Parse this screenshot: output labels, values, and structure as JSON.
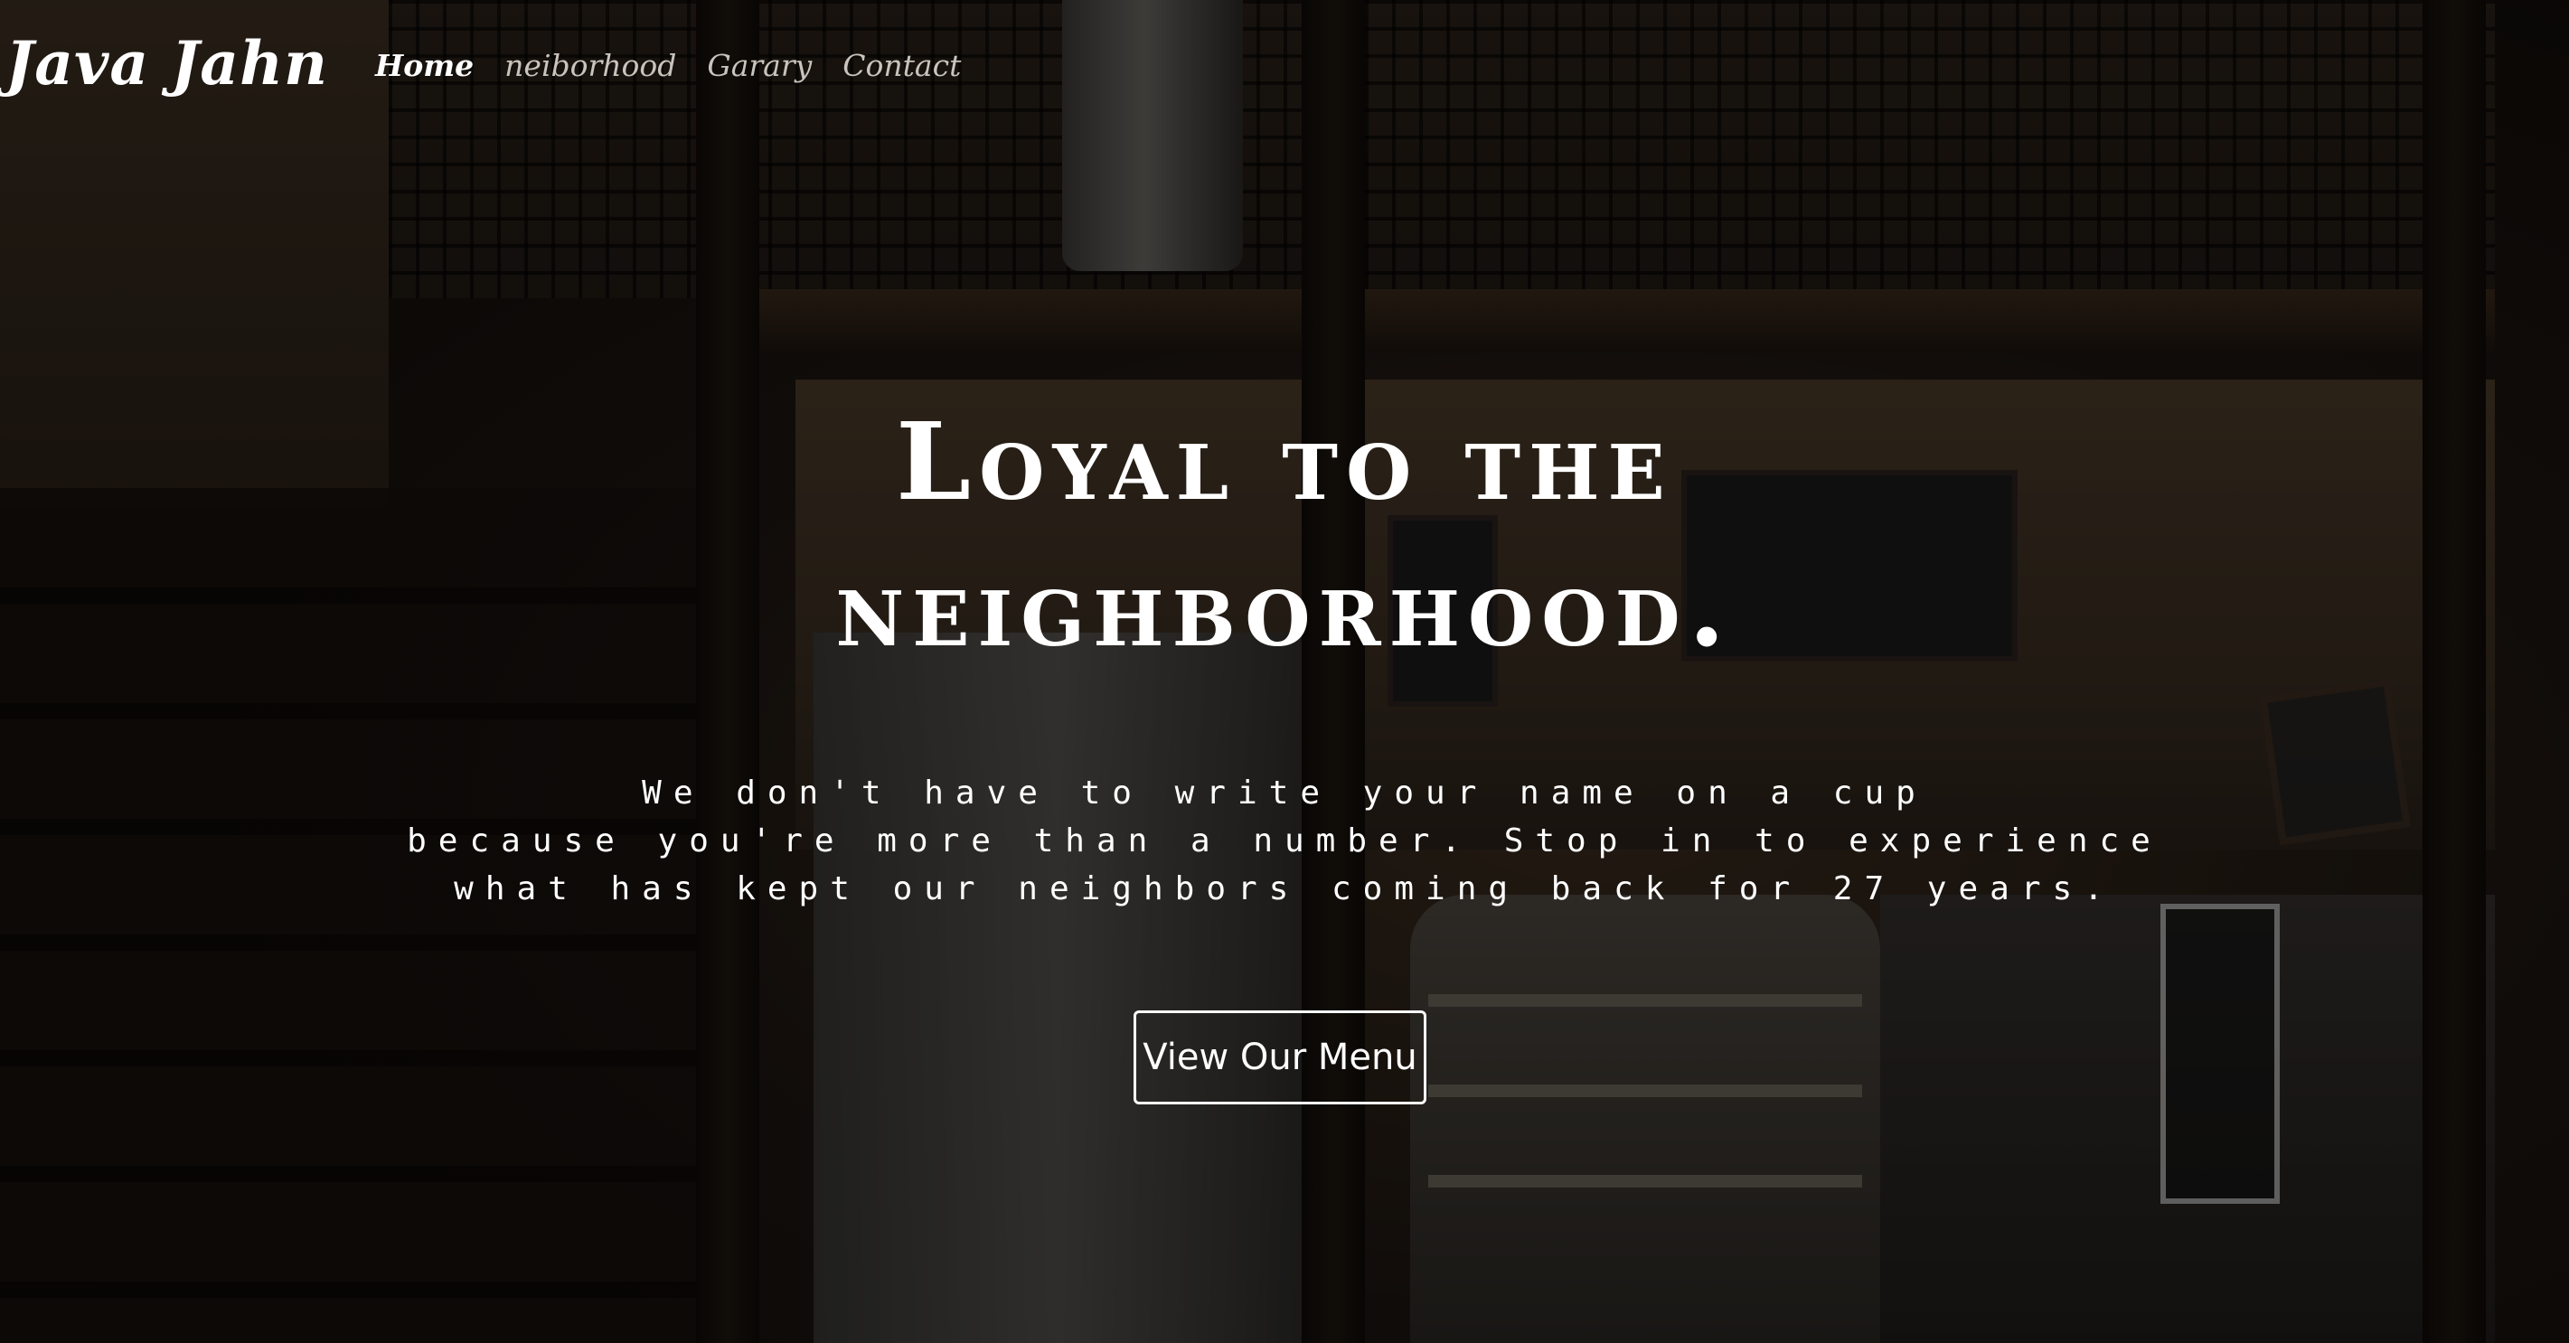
{
  "nav": {
    "brand": "Java Jahn",
    "links": [
      {
        "label": "Home",
        "active": true
      },
      {
        "label": "neiborhood",
        "active": false
      },
      {
        "label": "Garary",
        "active": false
      },
      {
        "label": "Contact",
        "active": false
      }
    ]
  },
  "hero": {
    "headline_lines": [
      "Loyal to the",
      "neighborhood."
    ],
    "tagline_lines": [
      "We don't have to write your name on a cup",
      "because you're more than a number. Stop in to experience",
      "what has kept our neighbors coming back for 27 years."
    ],
    "cta_label": "View Our Menu"
  }
}
